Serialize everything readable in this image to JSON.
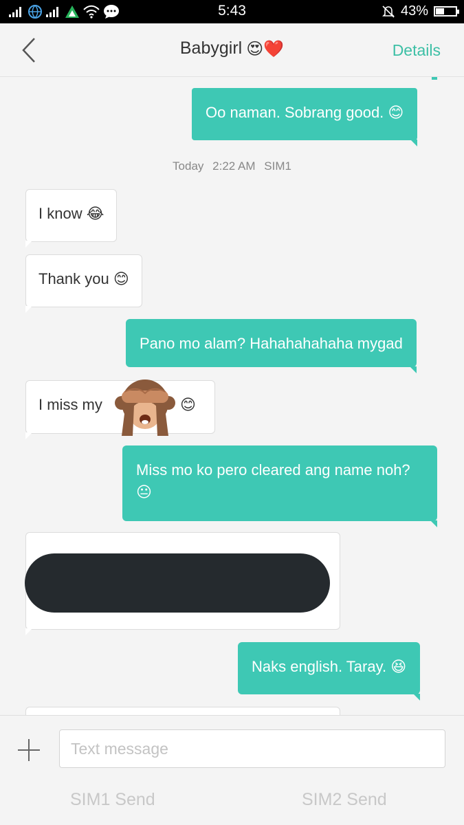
{
  "status_bar": {
    "time": "5:43",
    "battery_text": "43%",
    "battery_level": 0.43,
    "icons": [
      "signal-icon",
      "globe-icon",
      "signal-icon",
      "sim-icon",
      "wifi-icon",
      "chat-icon",
      "mute-bell-icon",
      "battery-icon"
    ]
  },
  "header": {
    "back_icon": "back-arrow-icon",
    "title": "Babygirl",
    "title_emoji": "😍❤️",
    "details": "Details"
  },
  "thread": {
    "timestamp": {
      "day": "Today",
      "time": "2:22 AM",
      "sim": "SIM1"
    },
    "messages": [
      {
        "dir": "out",
        "text": "Oo naman. Sobrang good.",
        "emoji": "😊"
      },
      {
        "dir": "in",
        "text": "I know",
        "emoji": "😂"
      },
      {
        "dir": "in",
        "text": "Thank you",
        "emoji": "😊"
      },
      {
        "dir": "out",
        "text": "Pano mo alam? Hahahahahaha mygad",
        "emoji": ""
      },
      {
        "dir": "in",
        "text": "I miss my",
        "emoji": "😊",
        "sticker": "see-no-evil-monkey"
      },
      {
        "dir": "out",
        "text": "Miss mo ko pero cleared ang name noh?",
        "emoji": "😐"
      },
      {
        "dir": "in",
        "text": "",
        "redacted": true
      },
      {
        "dir": "out",
        "text": "Naks english. Taray.",
        "emoji": "😆"
      }
    ]
  },
  "composer": {
    "placeholder": "Text message",
    "sim1_send": "SIM1 Send",
    "sim2_send": "SIM2 Send"
  },
  "colors": {
    "accent": "#3cbfa5",
    "outgoing_bubble": "#3ec8b4",
    "incoming_bubble": "#ffffff",
    "background": "#f4f4f4"
  }
}
